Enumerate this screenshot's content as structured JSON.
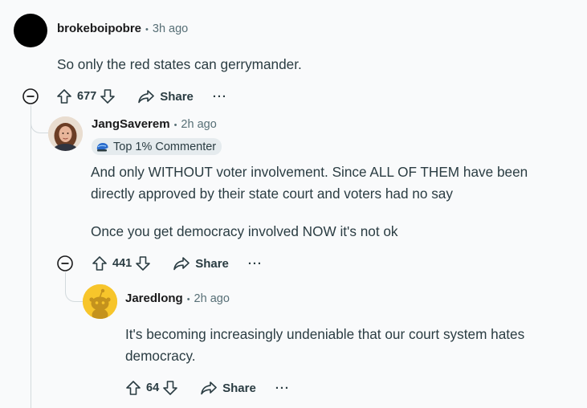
{
  "comments": [
    {
      "username": "brokeboipobre",
      "time": "3h ago",
      "body": [
        "So only the red states can gerrymander."
      ],
      "votes": "677",
      "share_label": "Share",
      "more_label": "···"
    },
    {
      "username": "JangSaverem",
      "time": "2h ago",
      "badge": "Top 1% Commenter",
      "body": [
        "And only WITHOUT voter involvement. Since ALL OF THEM have been",
        "directly approved by their state court and voters had no say",
        "Once you get democracy involved NOW it's not ok"
      ],
      "votes": "441",
      "share_label": "Share",
      "more_label": "···"
    },
    {
      "username": "Jaredlong",
      "time": "2h ago",
      "body": [
        "It's becoming increasingly undeniable that our court system hates",
        "democracy."
      ],
      "votes": "64",
      "share_label": "Share",
      "more_label": "···"
    }
  ],
  "separator": "•",
  "colors": {
    "background": "#f9fafb",
    "thread_line": "#d3dadd",
    "text": "#2a3c42",
    "meta": "#576f76",
    "badge_bg": "#e5ebee",
    "avatar_3": "#f7c52b"
  }
}
